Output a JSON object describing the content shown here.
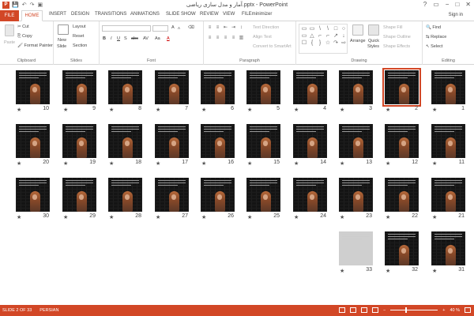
{
  "titlebar": {
    "title": "آمار و مدل سازی ریاضی.pptx - PowerPoint",
    "app_icon": "P",
    "qat": [
      "save-icon",
      "undo-icon",
      "redo-icon",
      "present-icon"
    ],
    "window_controls": [
      "?",
      "▭",
      "−",
      "□",
      "✕"
    ]
  },
  "tabs": {
    "file": "FILE",
    "items": [
      "HOME",
      "INSERT",
      "DESIGN",
      "TRANSITIONS",
      "ANIMATIONS",
      "SLIDE SHOW",
      "REVIEW",
      "VIEW",
      "FILEminimizer"
    ],
    "signin": "Sign in"
  },
  "ribbon": {
    "clipboard": {
      "label": "Clipboard",
      "paste": "Paste",
      "cut": "Cut",
      "copy": "Copy",
      "format_painter": "Format Painter"
    },
    "slides": {
      "label": "Slides",
      "new_slide": "New",
      "new_slide_2": "Slide",
      "layout": "Layout",
      "reset": "Reset",
      "section": "Section"
    },
    "font": {
      "label": "Font",
      "size_up": "A",
      "size_down": "A",
      "bold": "B",
      "italic": "I",
      "underline": "U",
      "strike": "S",
      "shadow": "abc",
      "spacing": "AV",
      "case": "Aa",
      "color": "A"
    },
    "paragraph": {
      "label": "Paragraph",
      "text_direction": "Text Direction",
      "align_text": "Align Text",
      "convert_smartart": "Convert to SmartArt"
    },
    "drawing": {
      "label": "Drawing",
      "arrange": "Arrange",
      "quick_styles": "Quick",
      "quick_styles_2": "Styles",
      "shape_fill": "Shape Fill",
      "shape_outline": "Shape Outline",
      "shape_effects": "Shape Effects",
      "shapes": [
        "▭",
        "▭",
        "\\",
        "\\",
        "□",
        "○",
        "▭",
        "△",
        "⌐",
        "⌐",
        "↗",
        "↓",
        "☐",
        "{",
        "}",
        "☆",
        "↷",
        "⇨"
      ]
    },
    "editing": {
      "label": "Editing",
      "find": "Find",
      "replace": "Replace",
      "select": "Select"
    }
  },
  "slides": [
    {
      "n": "10"
    },
    {
      "n": "9"
    },
    {
      "n": "8"
    },
    {
      "n": "7"
    },
    {
      "n": "6"
    },
    {
      "n": "5"
    },
    {
      "n": "4"
    },
    {
      "n": "3"
    },
    {
      "n": "2",
      "selected": true
    },
    {
      "n": "1"
    },
    {
      "n": "20"
    },
    {
      "n": "19"
    },
    {
      "n": "18"
    },
    {
      "n": "17"
    },
    {
      "n": "16"
    },
    {
      "n": "15"
    },
    {
      "n": "14"
    },
    {
      "n": "13"
    },
    {
      "n": "12"
    },
    {
      "n": "11"
    },
    {
      "n": "30"
    },
    {
      "n": "29"
    },
    {
      "n": "28"
    },
    {
      "n": "27"
    },
    {
      "n": "26"
    },
    {
      "n": "25"
    },
    {
      "n": "24"
    },
    {
      "n": "23"
    },
    {
      "n": "22"
    },
    {
      "n": "21"
    },
    {
      "n": "33",
      "light": true
    },
    {
      "n": "32"
    },
    {
      "n": "31"
    }
  ],
  "slide_star": "★",
  "statusbar": {
    "slide_info": "SLIDE 2 OF 33",
    "language": "PERSIAN",
    "zoom": "40 %"
  }
}
